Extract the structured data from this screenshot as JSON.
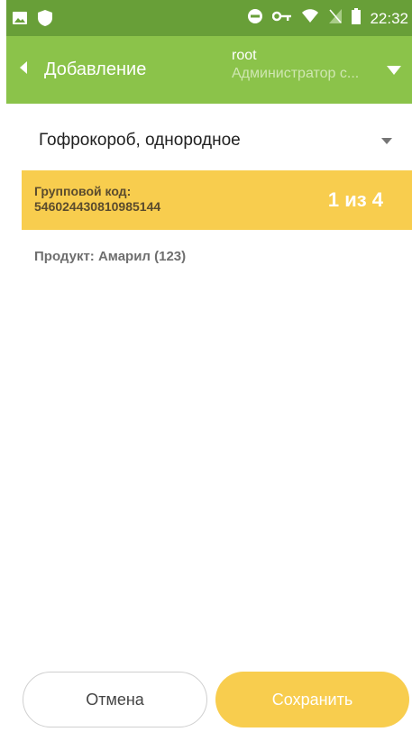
{
  "status_bar": {
    "time": "22:32"
  },
  "app_bar": {
    "title": "Добавление",
    "user_name": "root",
    "user_role": "Администратор с..."
  },
  "package_select": {
    "selected": "Гофрокороб, однородное"
  },
  "group_code": {
    "label": "Групповой код:",
    "value": "546024430810985144",
    "counter": "1 из 4"
  },
  "product": {
    "text": "Продукт: Амарил (123)"
  },
  "actions": {
    "cancel_label": "Отмена",
    "save_label": "Сохранить"
  },
  "colors": {
    "status_bar": "#689f38",
    "app_bar": "#8bc34a",
    "accent_yellow": "#f8cd4e"
  }
}
